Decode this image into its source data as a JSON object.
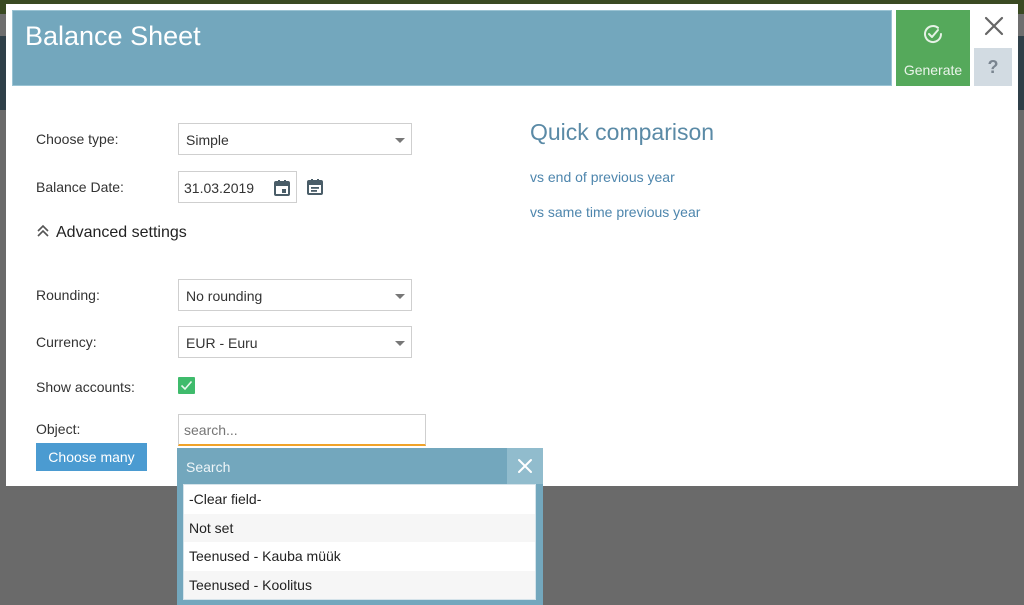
{
  "dialog": {
    "title": "Balance Sheet",
    "generate_label": "Generate",
    "help_label": "?"
  },
  "form": {
    "type_label": "Choose type:",
    "type_value": "Simple",
    "date_label": "Balance Date:",
    "date_value": "31.03.2019",
    "advanced_label": "Advanced settings",
    "rounding_label": "Rounding:",
    "rounding_value": "No rounding",
    "currency_label": "Currency:",
    "currency_value": "EUR - Euru",
    "show_accounts_label": "Show accounts:",
    "show_accounts_checked": true,
    "object_label": "Object:",
    "object_placeholder": "search...",
    "choose_many_label": "Choose many"
  },
  "quick_comparison": {
    "title": "Quick comparison",
    "links": [
      "vs end of previous year",
      "vs same time previous year"
    ]
  },
  "search_popup": {
    "title": "Search",
    "items": [
      "-Clear field-",
      "Not set",
      "Teenused - Kauba müük",
      "Teenused - Koolitus"
    ]
  },
  "colors": {
    "header": "#73a7bd",
    "generate": "#55a95b",
    "accent_link": "#4e86ad",
    "checkbox": "#3fbb6c",
    "focus_border": "#f0a32a"
  }
}
